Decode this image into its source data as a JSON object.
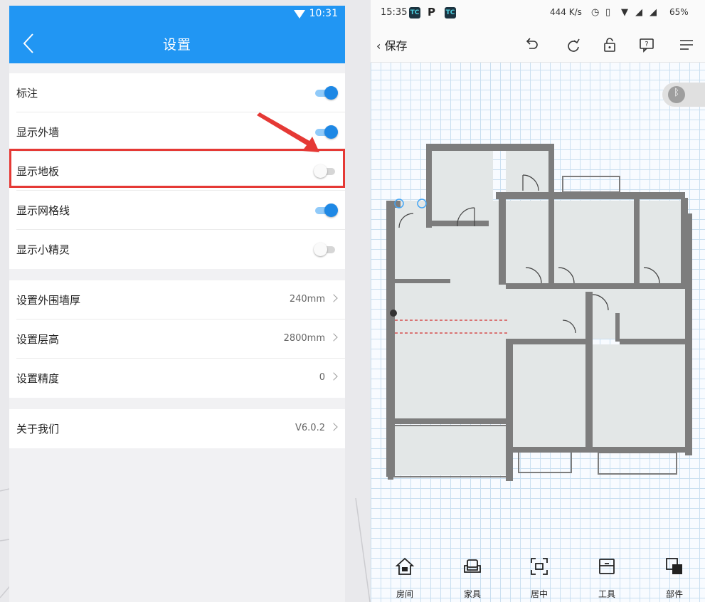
{
  "left": {
    "status_time": "10:31",
    "title": "设置",
    "toggles": [
      {
        "label": "标注",
        "on": true
      },
      {
        "label": "显示外墙",
        "on": true
      },
      {
        "label": "显示地板",
        "on": false
      },
      {
        "label": "显示网格线",
        "on": true
      },
      {
        "label": "显示小精灵",
        "on": false
      }
    ],
    "settings": [
      {
        "label": "设置外围墙厚",
        "value": "240mm"
      },
      {
        "label": "设置层高",
        "value": "2800mm"
      },
      {
        "label": "设置精度",
        "value": "0"
      }
    ],
    "about": {
      "label": "关于我们",
      "value": "V6.0.2"
    },
    "accent_color": "#2196f3",
    "highlight_color": "#e53935"
  },
  "right": {
    "status_time": "15:35",
    "status_app_icon": "TC",
    "status_p": "P",
    "net_speed": "444 K/s",
    "battery": "65%",
    "save_label": "保存",
    "bottom_nav": [
      {
        "label": "房间",
        "icon": "house-icon"
      },
      {
        "label": "家具",
        "icon": "sofa-icon"
      },
      {
        "label": "居中",
        "icon": "center-icon"
      },
      {
        "label": "工具",
        "icon": "toolbox-icon"
      },
      {
        "label": "部件",
        "icon": "component-icon"
      }
    ]
  }
}
